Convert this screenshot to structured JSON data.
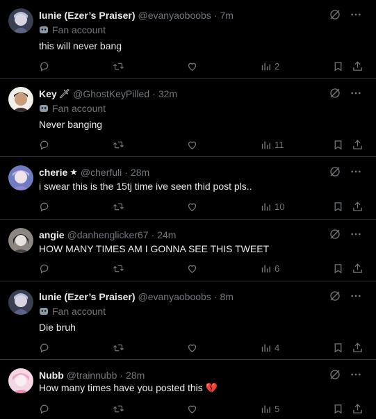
{
  "tweets": [
    {
      "name": "lunie (Ezer’s Praiser)",
      "name_emoji": "",
      "handle": "@evanyaoboobs",
      "time": "7m",
      "label": "Fan account",
      "text": "this will never bang",
      "text_suffix": "",
      "views": "2"
    },
    {
      "name": "Key",
      "name_emoji": "🗡",
      "handle": "@GhostKeyPilled",
      "time": "32m",
      "label": "Fan account",
      "text": "Never banging",
      "text_suffix": "",
      "views": "11"
    },
    {
      "name": "cherie",
      "name_emoji": "★",
      "handle": "@cherfuli",
      "time": "28m",
      "label": "",
      "text": "i swear this is the 15tj time ive seen thid post pls..",
      "text_suffix": "",
      "views": "10"
    },
    {
      "name": "angie",
      "name_emoji": "",
      "handle": "@danhenglicker67",
      "time": "24m",
      "label": "",
      "text": "HOW MANY TIMES AM I GONNA SEE THIS TWEET",
      "text_suffix": "",
      "views": "6"
    },
    {
      "name": "lunie (Ezer’s Praiser)",
      "name_emoji": "",
      "handle": "@evanyaoboobs",
      "time": "8m",
      "label": "Fan account",
      "text": "Die bruh",
      "text_suffix": "",
      "views": "4"
    },
    {
      "name": "Nubb",
      "name_emoji": "",
      "handle": "@trainnubb",
      "time": "28m",
      "label": "",
      "text": "How many times have you posted this",
      "text_suffix": "💔",
      "views": "5"
    }
  ],
  "separator": "·",
  "icons": {
    "reply": "reply-icon",
    "retweet": "retweet-icon",
    "like": "heart-icon",
    "views": "views-icon",
    "bookmark": "bookmark-icon",
    "share": "share-icon",
    "grok": "grok-icon",
    "more": "more-icon",
    "label": "mask-icon"
  },
  "colors": {
    "background": "#000000",
    "text": "#e7e9ea",
    "muted": "#71767b",
    "divider": "#2f3336",
    "broken_heart": "#f4212e"
  }
}
